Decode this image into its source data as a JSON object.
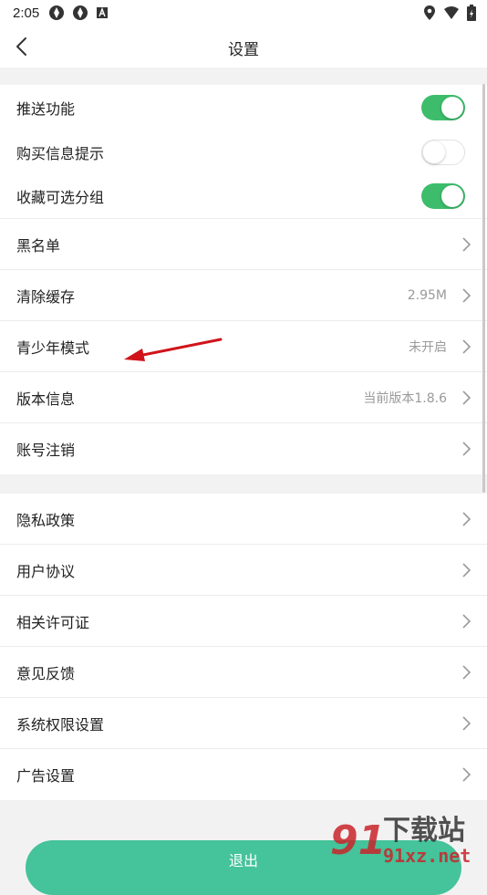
{
  "status_bar": {
    "time": "2:05",
    "left_icons": [
      "settings-app-icon",
      "settings-app-icon",
      "a-badge-icon"
    ],
    "right_icons": [
      "location-icon",
      "wifi-icon",
      "battery-icon"
    ]
  },
  "header": {
    "title": "设置",
    "back_icon": "chevron-left-icon"
  },
  "group1": {
    "toggles": [
      {
        "label": "推送功能",
        "on": true
      },
      {
        "label": "购买信息提示",
        "on": false
      },
      {
        "label": "收藏可选分组",
        "on": true
      }
    ],
    "items": [
      {
        "label": "黑名单",
        "value": ""
      },
      {
        "label": "清除缓存",
        "value": "2.95M"
      },
      {
        "label": "青少年模式",
        "value": "未开启"
      },
      {
        "label": "版本信息",
        "value": "当前版本1.8.6"
      },
      {
        "label": "账号注销",
        "value": ""
      }
    ]
  },
  "group2": {
    "items": [
      {
        "label": "隐私政策"
      },
      {
        "label": "用户协议"
      },
      {
        "label": "相关许可证"
      },
      {
        "label": "意见反馈"
      },
      {
        "label": "系统权限设置"
      },
      {
        "label": "广告设置"
      }
    ]
  },
  "logout": {
    "label": "退出"
  },
  "watermark": {
    "big": "下载站",
    "small": "91xz.net",
    "logo": "91"
  },
  "colors": {
    "accent": "#3dbd6c",
    "button": "#45c39a",
    "annotation": "#d0141a",
    "watermark": "#c9252b"
  }
}
